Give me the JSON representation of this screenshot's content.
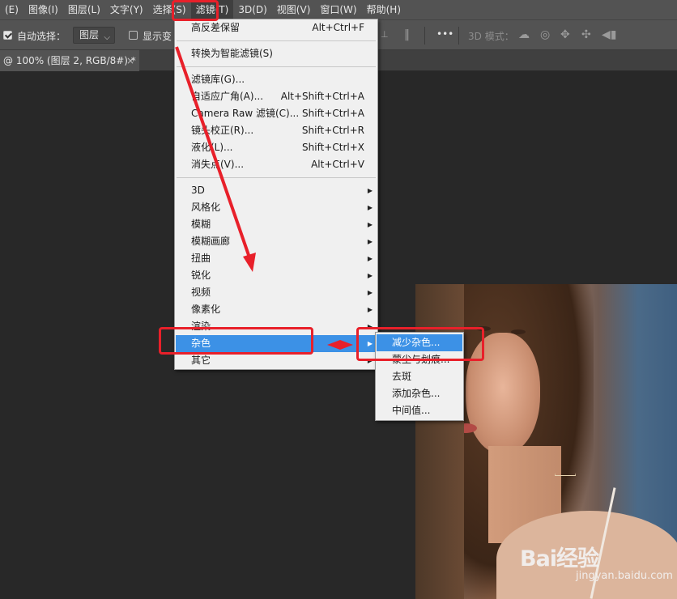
{
  "menubar": [
    {
      "label": "(E)",
      "active": false
    },
    {
      "label": "图像(I)",
      "active": false
    },
    {
      "label": "图层(L)",
      "active": false
    },
    {
      "label": "文字(Y)",
      "active": false
    },
    {
      "label": "选择(S)",
      "active": false
    },
    {
      "label": "滤镜(T)",
      "active": true
    },
    {
      "label": "3D(D)",
      "active": false
    },
    {
      "label": "视图(V)",
      "active": false
    },
    {
      "label": "窗口(W)",
      "active": false
    },
    {
      "label": "帮助(H)",
      "active": false
    }
  ],
  "options_bar": {
    "auto_select_label": "自动选择：",
    "auto_select_checked": true,
    "layer_select_value": "图层",
    "show_transform_label": "显示变",
    "show_transform_checked": false,
    "more_label": "•••",
    "mode_label": "3D 模式："
  },
  "document_tab": {
    "title": "@ 100% (图层 2, RGB/8#) *",
    "close": "×"
  },
  "filter_menu": {
    "items": [
      {
        "label": "高反差保留",
        "shortcut": "Alt+Ctrl+F"
      },
      {
        "separator": true
      },
      {
        "label": "转换为智能滤镜(S)",
        "shortcut": ""
      },
      {
        "separator": true
      },
      {
        "label": "滤镜库(G)...",
        "shortcut": ""
      },
      {
        "label": "自适应广角(A)...",
        "shortcut": "Alt+Shift+Ctrl+A"
      },
      {
        "label": "Camera Raw 滤镜(C)...",
        "shortcut": "Shift+Ctrl+A"
      },
      {
        "label": "镜头校正(R)...",
        "shortcut": "Shift+Ctrl+R"
      },
      {
        "label": "液化(L)...",
        "shortcut": "Shift+Ctrl+X"
      },
      {
        "label": "消失点(V)...",
        "shortcut": "Alt+Ctrl+V"
      },
      {
        "separator": true
      },
      {
        "label": "3D",
        "submenu": true
      },
      {
        "label": "风格化",
        "submenu": true
      },
      {
        "label": "模糊",
        "submenu": true
      },
      {
        "label": "模糊画廊",
        "submenu": true
      },
      {
        "label": "扭曲",
        "submenu": true
      },
      {
        "label": "锐化",
        "submenu": true
      },
      {
        "label": "视频",
        "submenu": true
      },
      {
        "label": "像素化",
        "submenu": true
      },
      {
        "label": "渲染",
        "submenu": true
      },
      {
        "label": "杂色",
        "submenu": true,
        "highlighted": true
      },
      {
        "label": "其它",
        "submenu": true
      }
    ]
  },
  "noise_submenu": {
    "items": [
      {
        "label": "减少杂色...",
        "highlighted": true
      },
      {
        "label": "蒙尘与划痕..."
      },
      {
        "label": "去斑"
      },
      {
        "label": "添加杂色..."
      },
      {
        "label": "中间值..."
      }
    ]
  },
  "watermark": {
    "brand": "Bai经验",
    "url": "jingyan.baidu.com"
  },
  "colors": {
    "menubar_bg": "#535353",
    "menu_bg": "#f0f0f0",
    "highlight": "#3c91e6",
    "annotation_red": "#e8202a",
    "canvas_bg": "#282828"
  }
}
